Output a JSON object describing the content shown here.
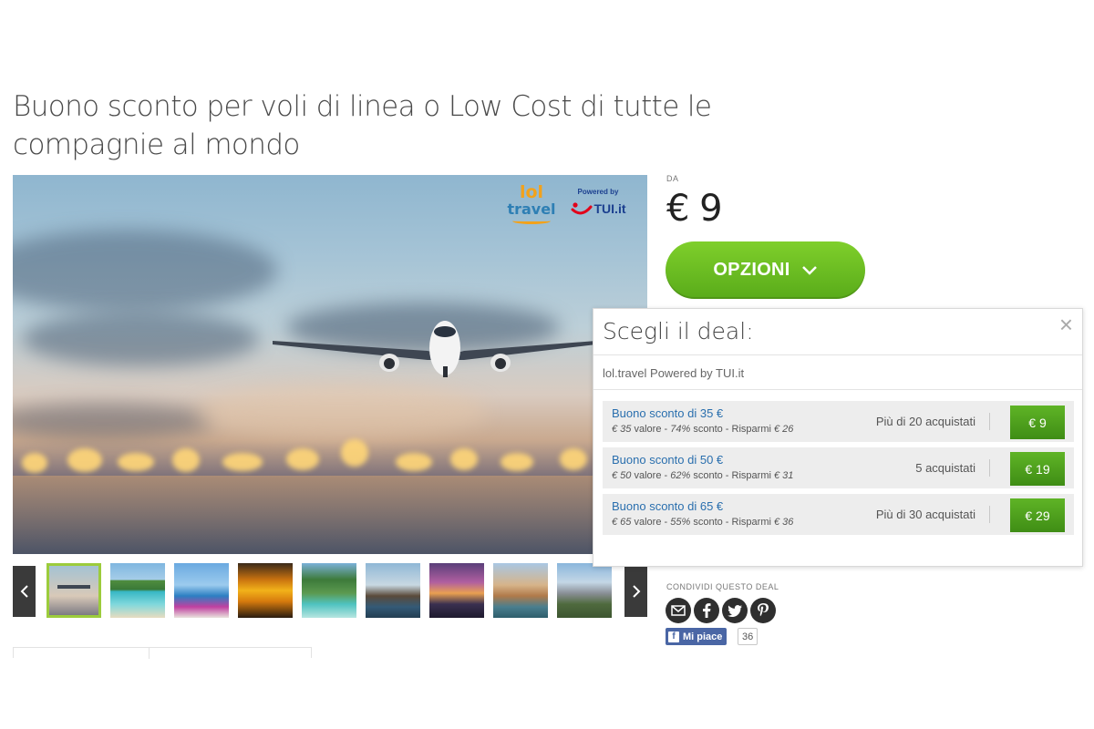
{
  "deal": {
    "title": "Buono sconto per voli di linea o Low Cost di tutte le compagnie al mondo"
  },
  "hero": {
    "brand_lol_top": "lol",
    "brand_lol_bottom": "travel",
    "brand_powered": "Powered by",
    "brand_tui": "TUI.it"
  },
  "gallery": {
    "prev_icon": "chevron-left-icon",
    "next_icon": "chevron-right-icon",
    "thumbnails": [
      "airplane",
      "tropical-beach",
      "seaside-flowers",
      "sunset",
      "tropical-resort",
      "temple",
      "city-skyline",
      "venice",
      "cathedral"
    ]
  },
  "pricing": {
    "from_label": "DA",
    "price": "€ 9",
    "options_label": "OPZIONI",
    "options_icon": "chevron-down-icon",
    "accent_color": "#6cbf22"
  },
  "popup": {
    "title": "Scegli il deal:",
    "close": "×",
    "merchant": "lol.travel Powered by TUI.it",
    "deals": [
      {
        "name": "Buono sconto di 35 €",
        "value": "€ 35",
        "value_label": "valore",
        "discount": "74%",
        "discount_label": "sconto",
        "savings_label": "Risparmi",
        "savings": "€ 26",
        "sold": "Più di 20 acquistati",
        "price": "€ 9"
      },
      {
        "name": "Buono sconto di 50 €",
        "value": "€ 50",
        "value_label": "valore",
        "discount": "62%",
        "discount_label": "sconto",
        "savings_label": "Risparmi",
        "savings": "€ 31",
        "sold": "5 acquistati",
        "price": "€ 19"
      },
      {
        "name": "Buono sconto di 65 €",
        "value": "€ 65",
        "value_label": "valore",
        "discount": "55%",
        "discount_label": "sconto",
        "savings_label": "Risparmi",
        "savings": "€ 36",
        "sold": "Più di 30 acquistati",
        "price": "€ 29"
      }
    ]
  },
  "share": {
    "label": "CONDIVIDI QUESTO DEAL",
    "icons": [
      "email-icon",
      "facebook-icon",
      "twitter-icon",
      "pinterest-icon"
    ],
    "like_label": "Mi piace",
    "like_count": "36"
  }
}
